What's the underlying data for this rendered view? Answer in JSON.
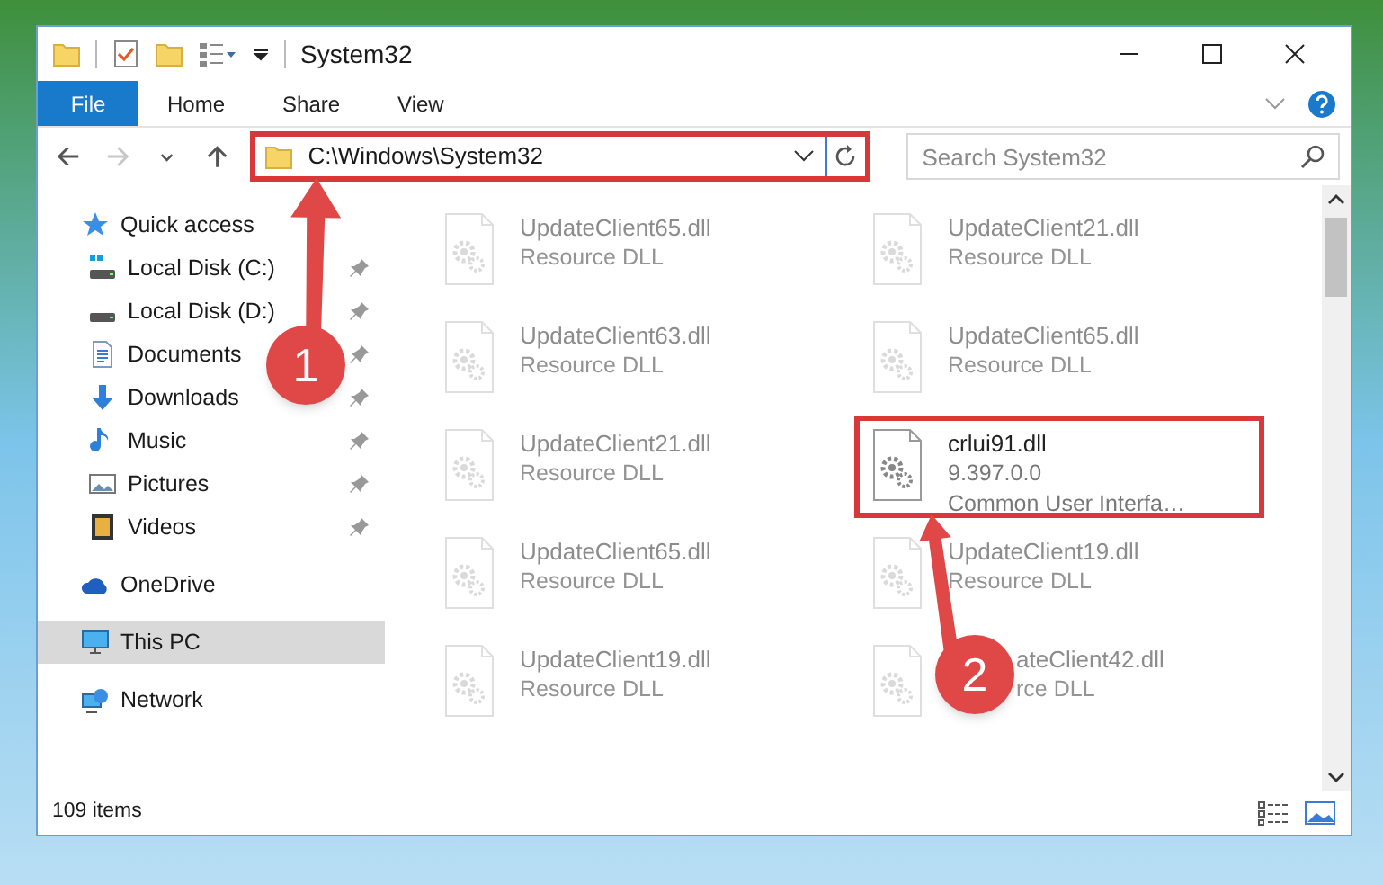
{
  "window": {
    "title": "System32"
  },
  "ribbon_tabs": [
    {
      "label": "File",
      "kind": "file"
    },
    {
      "label": "Home",
      "kind": "tab"
    },
    {
      "label": "Share",
      "kind": "tab"
    },
    {
      "label": "View",
      "kind": "tab"
    }
  ],
  "nav_buttons": [
    {
      "kind": "back",
      "disabled": false
    },
    {
      "kind": "forward",
      "disabled": true
    },
    {
      "kind": "recent",
      "disabled": false
    },
    {
      "kind": "up",
      "disabled": false
    }
  ],
  "address": {
    "path": "C:\\Windows\\System32",
    "highlighted": true
  },
  "search": {
    "placeholder": "Search System32"
  },
  "sidebar": {
    "items": [
      {
        "label": "Quick access",
        "kind": "star",
        "selected": false,
        "children": [
          {
            "label": "Local Disk (C:)",
            "kind": "drive-c",
            "pinned": true,
            "selected": false
          },
          {
            "label": "Local Disk (D:)",
            "kind": "drive",
            "pinned": true,
            "selected": false
          },
          {
            "label": "Documents",
            "kind": "documents",
            "pinned": true,
            "selected": false
          },
          {
            "label": "Downloads",
            "kind": "downloads",
            "pinned": true,
            "selected": false
          },
          {
            "label": "Music",
            "kind": "music",
            "pinned": true,
            "selected": false
          },
          {
            "label": "Pictures",
            "kind": "pictures",
            "pinned": true,
            "selected": false
          },
          {
            "label": "Videos",
            "kind": "videos",
            "pinned": true,
            "selected": false
          }
        ]
      },
      {
        "label": "OneDrive",
        "kind": "cloud",
        "selected": false
      },
      {
        "label": "This PC",
        "kind": "pc",
        "selected": true
      },
      {
        "label": "Network",
        "kind": "network",
        "selected": false
      }
    ]
  },
  "files": [
    {
      "name": "UpdateClient65.dll",
      "details": [
        "Resource DLL"
      ],
      "dimmed": true,
      "highlighted": false
    },
    {
      "name": "UpdateClient21.dll",
      "details": [
        "Resource DLL"
      ],
      "dimmed": true,
      "highlighted": false
    },
    {
      "name": "UpdateClient63.dll",
      "details": [
        "Resource DLL"
      ],
      "dimmed": true,
      "highlighted": false
    },
    {
      "name": "UpdateClient65.dll",
      "details": [
        "Resource DLL"
      ],
      "dimmed": true,
      "highlighted": false
    },
    {
      "name": "UpdateClient21.dll",
      "details": [
        "Resource DLL"
      ],
      "dimmed": true,
      "highlighted": false
    },
    {
      "name": "crlui91.dll",
      "details": [
        "9.397.0.0",
        "Common User Interfa…"
      ],
      "dimmed": false,
      "highlighted": true
    },
    {
      "name": "UpdateClient65.dll",
      "details": [
        "Resource DLL"
      ],
      "dimmed": true,
      "highlighted": false
    },
    {
      "name": "UpdateClient19.dll",
      "details": [
        "Resource DLL"
      ],
      "dimmed": true,
      "highlighted": false
    },
    {
      "name": "UpdateClient19.dll",
      "details": [
        "Resource DLL"
      ],
      "dimmed": true,
      "highlighted": false
    },
    {
      "name": "ateClient42.dll",
      "details": [
        "rce DLL"
      ],
      "dimmed": true,
      "highlighted": false,
      "kind": "covered"
    }
  ],
  "status_bar": {
    "item_count": "109 items"
  },
  "callouts": [
    {
      "number": "1"
    },
    {
      "number": "2"
    }
  ]
}
